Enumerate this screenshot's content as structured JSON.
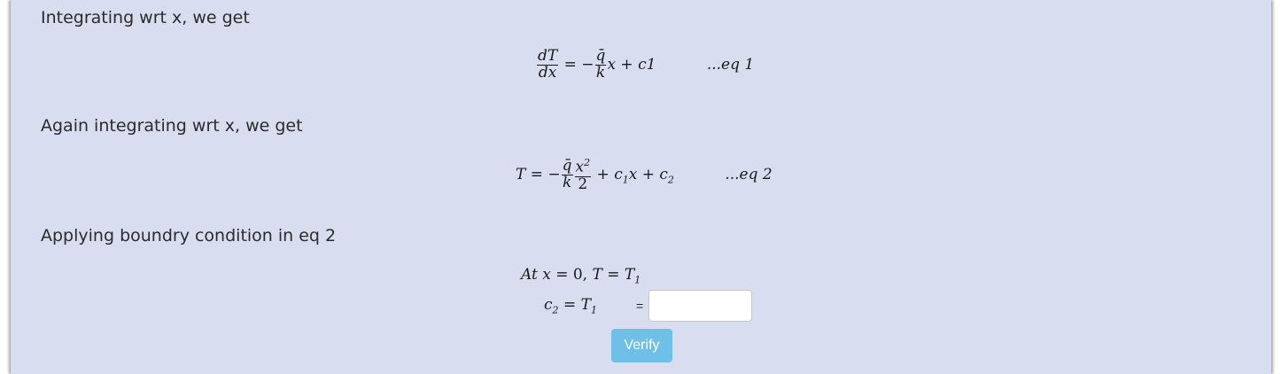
{
  "steps": [
    {
      "heading": "Integrating wrt x, we get",
      "equation": {
        "lhs_num": "dT",
        "lhs_den": "dx",
        "eq": "=",
        "minus": "−",
        "frac_num": "q̄",
        "frac_den": "k",
        "rest": "x + c1",
        "tag": "...eq 1"
      }
    },
    {
      "heading": "Again integrating wrt x, we get",
      "equation": {
        "lhs": "T",
        "eq": "=",
        "minus": "−",
        "frac1_num": "q̄",
        "frac1_den": "k",
        "frac2_num": "x",
        "frac2_num_sup": "2",
        "frac2_den": "2",
        "plus1": "+",
        "c1": "c",
        "c1_sub": "1",
        "c1_var": "x",
        "plus2": "+",
        "c2": "c",
        "c2_sub": "2",
        "tag": "...eq 2"
      }
    },
    {
      "heading": "Applying boundry condition in eq 2",
      "condition": {
        "text_at": "At",
        "var_x": "x",
        "eq1": "= 0,",
        "var_T": "T",
        "eq2": "=",
        "T1": "T",
        "T1_sub": "1"
      },
      "answer": {
        "c": "c",
        "c_sub": "2",
        "eq": "=",
        "T": "T",
        "T_sub": "1",
        "equals_label": "=",
        "input_value": "",
        "input_placeholder": ""
      }
    }
  ],
  "verify_label": "Verify",
  "colors": {
    "panel_bg": "#d8def0",
    "verify_bg": "#6fc0e6",
    "heading_text": "#2b2b2b"
  }
}
